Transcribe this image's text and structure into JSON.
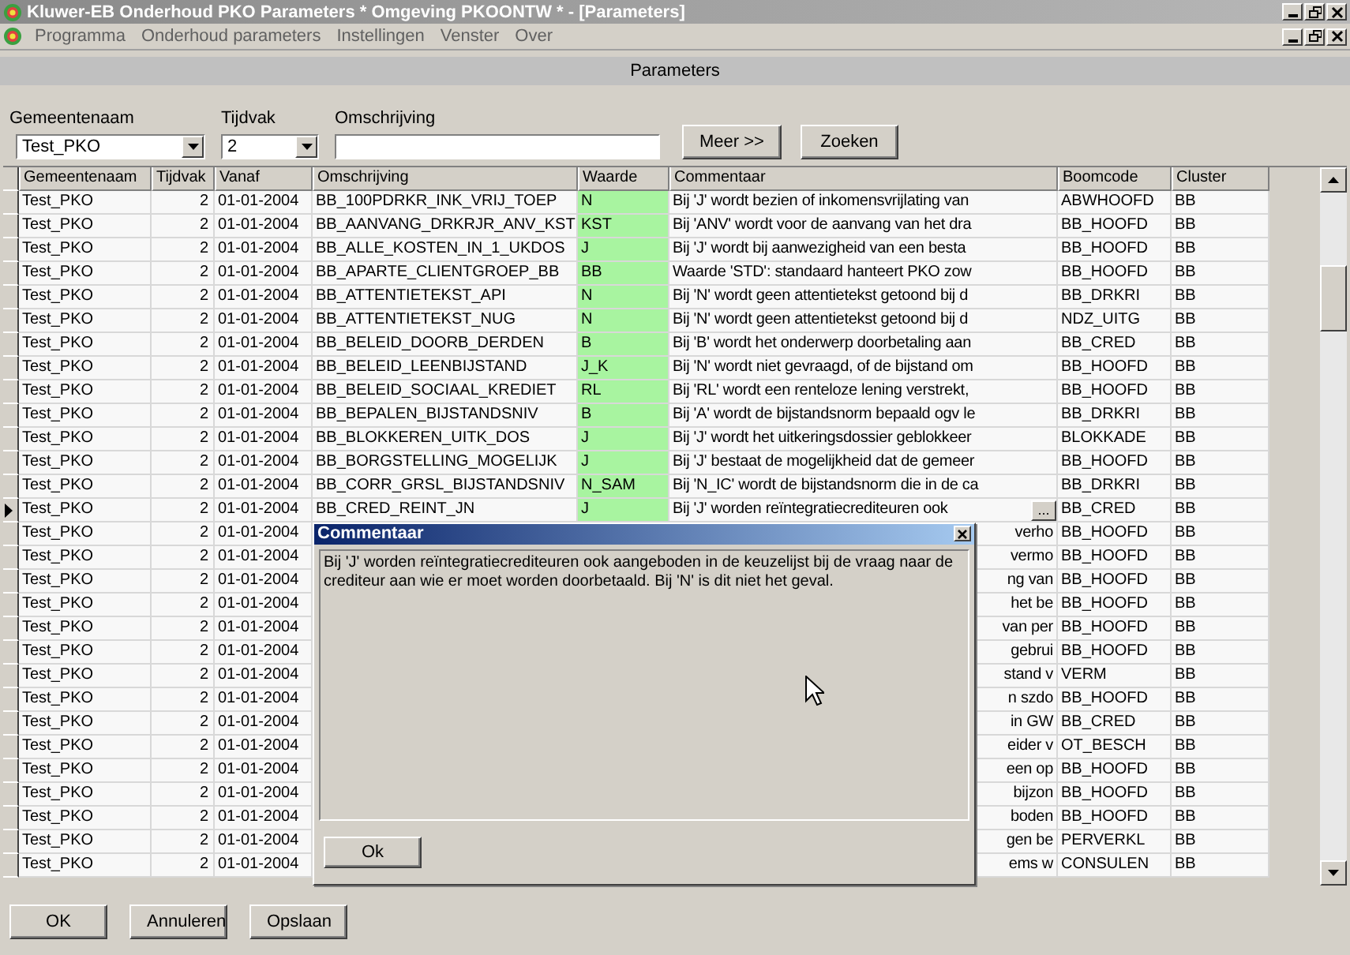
{
  "window": {
    "title": "Kluwer-EB Onderhoud PKO Parameters * Omgeving PKOONTW * - [Parameters]"
  },
  "menu": [
    "Programma",
    "Onderhoud parameters",
    "Instellingen",
    "Venster",
    "Over"
  ],
  "panel_title": "Parameters",
  "filters": [
    {
      "label": "Gemeentenaam",
      "kind": "combo",
      "value": "Test_PKO"
    },
    {
      "label": "Tijdvak",
      "kind": "combo",
      "value": "2"
    },
    {
      "label": "Omschrijving",
      "kind": "text"
    }
  ],
  "filter_buttons": [
    "Meer >>",
    "Zoeken"
  ],
  "table": {
    "columns": [
      "Gemeentenaam",
      "Tijdvak",
      "Vanaf",
      "Omschrijving",
      "Waarde",
      "Commentaar",
      "Boomcode",
      "Cluster"
    ],
    "rows": [
      {
        "gemeentenaam": "Test_PKO",
        "tijdvak": "2",
        "vanaf": "01-01-2004",
        "omschrijving": "BB_100PDRKR_INK_VRIJ_TOEP",
        "waarde": "N",
        "commentaar": "Bij 'J' wordt bezien of inkomensvrijlating van",
        "boomcode": "ABWHOOFD",
        "cluster": "BB",
        "selected": false
      },
      {
        "gemeentenaam": "Test_PKO",
        "tijdvak": "2",
        "vanaf": "01-01-2004",
        "omschrijving": "BB_AANVANG_DRKRJR_ANV_KST",
        "waarde": "KST",
        "commentaar": "Bij 'ANV' wordt voor de aanvang van het dra",
        "boomcode": "BB_HOOFD",
        "cluster": "BB",
        "selected": false
      },
      {
        "gemeentenaam": "Test_PKO",
        "tijdvak": "2",
        "vanaf": "01-01-2004",
        "omschrijving": "BB_ALLE_KOSTEN_IN_1_UKDOS",
        "waarde": "J",
        "commentaar": "Bij 'J' wordt bij aanwezigheid van een besta",
        "boomcode": "BB_HOOFD",
        "cluster": "BB",
        "selected": false
      },
      {
        "gemeentenaam": "Test_PKO",
        "tijdvak": "2",
        "vanaf": "01-01-2004",
        "omschrijving": "BB_APARTE_CLIENTGROEP_BB",
        "waarde": "BB",
        "commentaar": "Waarde 'STD': standaard hanteert PKO zow",
        "boomcode": "BB_HOOFD",
        "cluster": "BB",
        "selected": false
      },
      {
        "gemeentenaam": "Test_PKO",
        "tijdvak": "2",
        "vanaf": "01-01-2004",
        "omschrijving": "BB_ATTENTIETEKST_API",
        "waarde": "N",
        "commentaar": "Bij 'N' wordt geen attentietekst getoond bij d",
        "boomcode": "BB_DRKRI",
        "cluster": "BB",
        "selected": false
      },
      {
        "gemeentenaam": "Test_PKO",
        "tijdvak": "2",
        "vanaf": "01-01-2004",
        "omschrijving": "BB_ATTENTIETEKST_NUG",
        "waarde": "N",
        "commentaar": "Bij 'N' wordt geen attentietekst getoond bij d",
        "boomcode": "NDZ_UITG",
        "cluster": "BB",
        "selected": false
      },
      {
        "gemeentenaam": "Test_PKO",
        "tijdvak": "2",
        "vanaf": "01-01-2004",
        "omschrijving": "BB_BELEID_DOORB_DERDEN",
        "waarde": "B",
        "commentaar": "Bij 'B' wordt het onderwerp doorbetaling aan",
        "boomcode": "BB_CRED",
        "cluster": "BB",
        "selected": false
      },
      {
        "gemeentenaam": "Test_PKO",
        "tijdvak": "2",
        "vanaf": "01-01-2004",
        "omschrijving": "BB_BELEID_LEENBIJSTAND",
        "waarde": "J_K",
        "commentaar": "Bij 'N' wordt niet gevraagd, of de bijstand om",
        "boomcode": "BB_HOOFD",
        "cluster": "BB",
        "selected": false
      },
      {
        "gemeentenaam": "Test_PKO",
        "tijdvak": "2",
        "vanaf": "01-01-2004",
        "omschrijving": "BB_BELEID_SOCIAAL_KREDIET",
        "waarde": "RL",
        "commentaar": "Bij 'RL' wordt een renteloze lening verstrekt,",
        "boomcode": "BB_HOOFD",
        "cluster": "BB",
        "selected": false
      },
      {
        "gemeentenaam": "Test_PKO",
        "tijdvak": "2",
        "vanaf": "01-01-2004",
        "omschrijving": "BB_BEPALEN_BIJSTANDSNIV",
        "waarde": "B",
        "commentaar": "Bij 'A' wordt de bijstandsnorm bepaald ogv le",
        "boomcode": "BB_DRKRI",
        "cluster": "BB",
        "selected": false
      },
      {
        "gemeentenaam": "Test_PKO",
        "tijdvak": "2",
        "vanaf": "01-01-2004",
        "omschrijving": "BB_BLOKKEREN_UITK_DOS",
        "waarde": "J",
        "commentaar": "Bij 'J' wordt het uitkeringsdossier geblokkeer",
        "boomcode": "BLOKKADE",
        "cluster": "BB",
        "selected": false
      },
      {
        "gemeentenaam": "Test_PKO",
        "tijdvak": "2",
        "vanaf": "01-01-2004",
        "omschrijving": "BB_BORGSTELLING_MOGELIJK",
        "waarde": "J",
        "commentaar": "Bij 'J' bestaat de mogelijkheid dat de gemeer",
        "boomcode": "BB_HOOFD",
        "cluster": "BB",
        "selected": false
      },
      {
        "gemeentenaam": "Test_PKO",
        "tijdvak": "2",
        "vanaf": "01-01-2004",
        "omschrijving": "BB_CORR_GRSL_BIJSTANDSNIV",
        "waarde": "N_SAM",
        "commentaar": "Bij 'N_IC' wordt de bijstandsnorm die in de ca",
        "boomcode": "BB_DRKRI",
        "cluster": "BB",
        "selected": false
      },
      {
        "gemeentenaam": "Test_PKO",
        "tijdvak": "2",
        "vanaf": "01-01-2004",
        "omschrijving": "BB_CRED_REINT_JN",
        "waarde": "J",
        "commentaar": "Bij 'J' worden reïntegratiecrediteuren ook",
        "edit_button": "...",
        "boomcode": "BB_CRED",
        "cluster": "BB",
        "selected": true
      },
      {
        "gemeentenaam": "Test_PKO",
        "tijdvak": "2",
        "vanaf": "01-01-2004",
        "commentaar": "verho",
        "boomcode": "BB_HOOFD",
        "cluster": "BB",
        "selected": false
      },
      {
        "gemeentenaam": "Test_PKO",
        "tijdvak": "2",
        "vanaf": "01-01-2004",
        "commentaar": "vermo",
        "boomcode": "BB_HOOFD",
        "cluster": "BB",
        "selected": false
      },
      {
        "gemeentenaam": "Test_PKO",
        "tijdvak": "2",
        "vanaf": "01-01-2004",
        "commentaar": "ng van",
        "boomcode": "BB_HOOFD",
        "cluster": "BB",
        "selected": false
      },
      {
        "gemeentenaam": "Test_PKO",
        "tijdvak": "2",
        "vanaf": "01-01-2004",
        "commentaar": "het be",
        "boomcode": "BB_HOOFD",
        "cluster": "BB",
        "selected": false
      },
      {
        "gemeentenaam": "Test_PKO",
        "tijdvak": "2",
        "vanaf": "01-01-2004",
        "commentaar": "van per",
        "boomcode": "BB_HOOFD",
        "cluster": "BB",
        "selected": false
      },
      {
        "gemeentenaam": "Test_PKO",
        "tijdvak": "2",
        "vanaf": "01-01-2004",
        "commentaar": "gebrui",
        "boomcode": "BB_HOOFD",
        "cluster": "BB",
        "selected": false
      },
      {
        "gemeentenaam": "Test_PKO",
        "tijdvak": "2",
        "vanaf": "01-01-2004",
        "commentaar": "stand v",
        "boomcode": "VERM",
        "cluster": "BB",
        "selected": false
      },
      {
        "gemeentenaam": "Test_PKO",
        "tijdvak": "2",
        "vanaf": "01-01-2004",
        "commentaar": "n szdo",
        "boomcode": "BB_HOOFD",
        "cluster": "BB",
        "selected": false
      },
      {
        "gemeentenaam": "Test_PKO",
        "tijdvak": "2",
        "vanaf": "01-01-2004",
        "commentaar": "in GW",
        "boomcode": "BB_CRED",
        "cluster": "BB",
        "selected": false
      },
      {
        "gemeentenaam": "Test_PKO",
        "tijdvak": "2",
        "vanaf": "01-01-2004",
        "commentaar": "eider v",
        "boomcode": "OT_BESCH",
        "cluster": "BB",
        "selected": false
      },
      {
        "gemeentenaam": "Test_PKO",
        "tijdvak": "2",
        "vanaf": "01-01-2004",
        "commentaar": "een op",
        "boomcode": "BB_HOOFD",
        "cluster": "BB",
        "selected": false
      },
      {
        "gemeentenaam": "Test_PKO",
        "tijdvak": "2",
        "vanaf": "01-01-2004",
        "commentaar": "bijzon",
        "boomcode": "BB_HOOFD",
        "cluster": "BB",
        "selected": false
      },
      {
        "gemeentenaam": "Test_PKO",
        "tijdvak": "2",
        "vanaf": "01-01-2004",
        "commentaar": "boden",
        "boomcode": "BB_HOOFD",
        "cluster": "BB",
        "selected": false
      },
      {
        "gemeentenaam": "Test_PKO",
        "tijdvak": "2",
        "vanaf": "01-01-2004",
        "commentaar": "gen be",
        "boomcode": "PERVERKL",
        "cluster": "BB",
        "selected": false
      },
      {
        "gemeentenaam": "Test_PKO",
        "tijdvak": "2",
        "vanaf": "01-01-2004",
        "commentaar": "ems w",
        "boomcode": "CONSULEN",
        "cluster": "BB",
        "selected": false
      }
    ]
  },
  "dialog": {
    "title": "Commentaar",
    "text": "Bij 'J' worden reïntegratiecrediteuren ook aangeboden in de keuzelijst bij de vraag naar de crediteur aan wie er moet worden doorbetaald. Bij 'N' is dit niet het geval.",
    "button": "Ok"
  },
  "buttons": [
    "OK",
    "Annuleren",
    "Opslaan"
  ]
}
